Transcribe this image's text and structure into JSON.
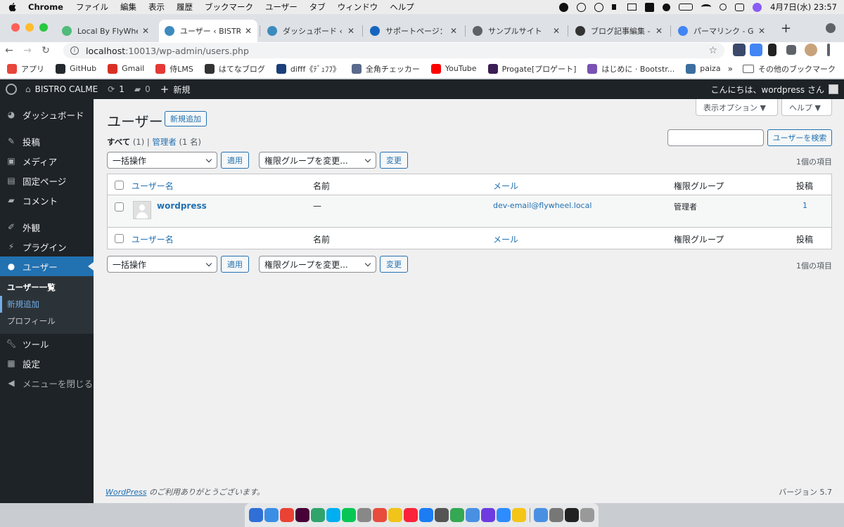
{
  "menubar": {
    "app": "Chrome",
    "items": [
      "ファイル",
      "編集",
      "表示",
      "履歴",
      "ブックマーク",
      "ユーザー",
      "タブ",
      "ウィンドウ",
      "ヘルプ"
    ],
    "clock": "4月7日(水)  23:57"
  },
  "tabs": [
    {
      "title": "Local By FlyWheel",
      "color": "#51bb7b"
    },
    {
      "title": "ユーザー ‹ BISTRO C",
      "color": "#3c8bbf"
    },
    {
      "title": "ダッシュボード ‹ BIS",
      "color": "#3c8bbf"
    },
    {
      "title": "サポートページ：［",
      "color": "#1565c0"
    },
    {
      "title": "サンプルサイト",
      "color": "#5f6368"
    },
    {
      "title": "ブログ記事編集 - はて",
      "color": "#333333"
    },
    {
      "title": "パーマリンク - Goog",
      "color": "#4285f4"
    }
  ],
  "address": {
    "host": "localhost",
    "path": ":10013/wp-admin/users.php"
  },
  "bookmarks": [
    {
      "label": "アプリ",
      "color": "#e8453c"
    },
    {
      "label": "GitHub",
      "color": "#24292e"
    },
    {
      "label": "Gmail",
      "color": "#d93025"
    },
    {
      "label": "侍LMS",
      "color": "#e53935"
    },
    {
      "label": "はてなブログ",
      "color": "#333333"
    },
    {
      "label": "difff《ﾃﾞｭﾌﾌ》",
      "color": "#1a3f7a"
    },
    {
      "label": "全角チェッカー",
      "color": "#5a6a8c"
    },
    {
      "label": "YouTube",
      "color": "#ff0000"
    },
    {
      "label": "Progate[プロゲート]",
      "color": "#3b1e54"
    },
    {
      "label": "はじめに · Bootstr...",
      "color": "#7952b3"
    },
    {
      "label": "paiza",
      "color": "#3c6e9f"
    }
  ],
  "bookmarks_other": "その他のブックマーク",
  "adminbar": {
    "site": "BISTRO CALME",
    "updates": "1",
    "comments": "0",
    "new": "新規",
    "howdy": "こんにちは、wordpress さん"
  },
  "sidebar": {
    "items": [
      {
        "label": "ダッシュボード",
        "icon": "dashboard-icon"
      },
      {
        "label": "投稿",
        "icon": "pin-icon"
      },
      {
        "label": "メディア",
        "icon": "media-icon"
      },
      {
        "label": "固定ページ",
        "icon": "page-icon"
      },
      {
        "label": "コメント",
        "icon": "comment-icon"
      },
      {
        "label": "外観",
        "icon": "brush-icon"
      },
      {
        "label": "プラグイン",
        "icon": "plugin-icon"
      },
      {
        "label": "ユーザー",
        "icon": "user-icon"
      },
      {
        "label": "ツール",
        "icon": "wrench-icon"
      },
      {
        "label": "設定",
        "icon": "settings-icon"
      },
      {
        "label": "メニューを閉じる",
        "icon": "collapse-icon"
      }
    ],
    "submenu": [
      "ユーザー一覧",
      "新規追加",
      "プロフィール"
    ]
  },
  "page": {
    "title": "ユーザー",
    "add_new": "新規追加",
    "screen_options": "表示オプション ▼",
    "help": "ヘルプ ▼",
    "filter_all": "すべて",
    "filter_all_count": "(1)",
    "filter_admin": "管理者",
    "filter_admin_count": "(1 名)",
    "search_button": "ユーザーを検索",
    "bulk_action": "一括操作",
    "apply": "適用",
    "change_role": "権限グループを変更...",
    "change": "変更",
    "items_count": "1個の項目"
  },
  "table": {
    "columns": {
      "username": "ユーザー名",
      "name": "名前",
      "email": "メール",
      "role": "権限グループ",
      "posts": "投稿"
    },
    "rows": [
      {
        "username": "wordpress",
        "name": "—",
        "email": "dev-email@flywheel.local",
        "role": "管理者",
        "posts": "1"
      }
    ]
  },
  "footer": {
    "link": "WordPress",
    "thanks": " のご利用ありがとうございます。",
    "version": "バージョン 5.7"
  },
  "dock": [
    "#2f6fd6",
    "#3a8ee6",
    "#ea4335",
    "#470137",
    "#30a46c",
    "#00aff0",
    "#06c755",
    "#888888",
    "#e74c3c",
    "#f0c419",
    "#fa233b",
    "#1c7cf4",
    "#555555",
    "#34a853",
    "#4a90e2",
    "#6c3ce0",
    "#2d8cff",
    "#f5c518",
    "#4a90e2",
    "#777777",
    "#222222",
    "#999999"
  ]
}
